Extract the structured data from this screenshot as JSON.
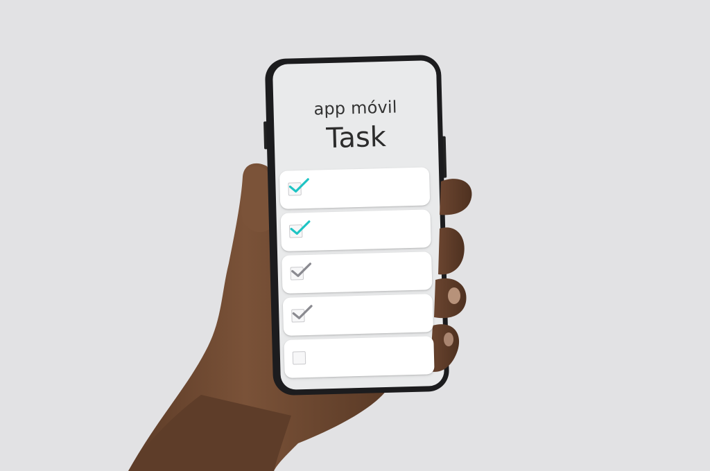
{
  "app": {
    "subtitle": "app móvil",
    "title": "Task"
  },
  "tasks": [
    {
      "checked": true,
      "check_color": "#1fc4c4"
    },
    {
      "checked": true,
      "check_color": "#1fc4c4"
    },
    {
      "checked": true,
      "check_color": "#8a8a90"
    },
    {
      "checked": true,
      "check_color": "#8a8a90"
    },
    {
      "checked": false,
      "check_color": "#8a8a90"
    }
  ],
  "colors": {
    "background": "#e2e2e4",
    "phone_frame": "#1c1c1e",
    "screen": "#e9eaeb",
    "card": "#ffffff",
    "accent_check": "#1fc4c4",
    "muted_check": "#8a8a90",
    "skin": "#6b4731"
  }
}
